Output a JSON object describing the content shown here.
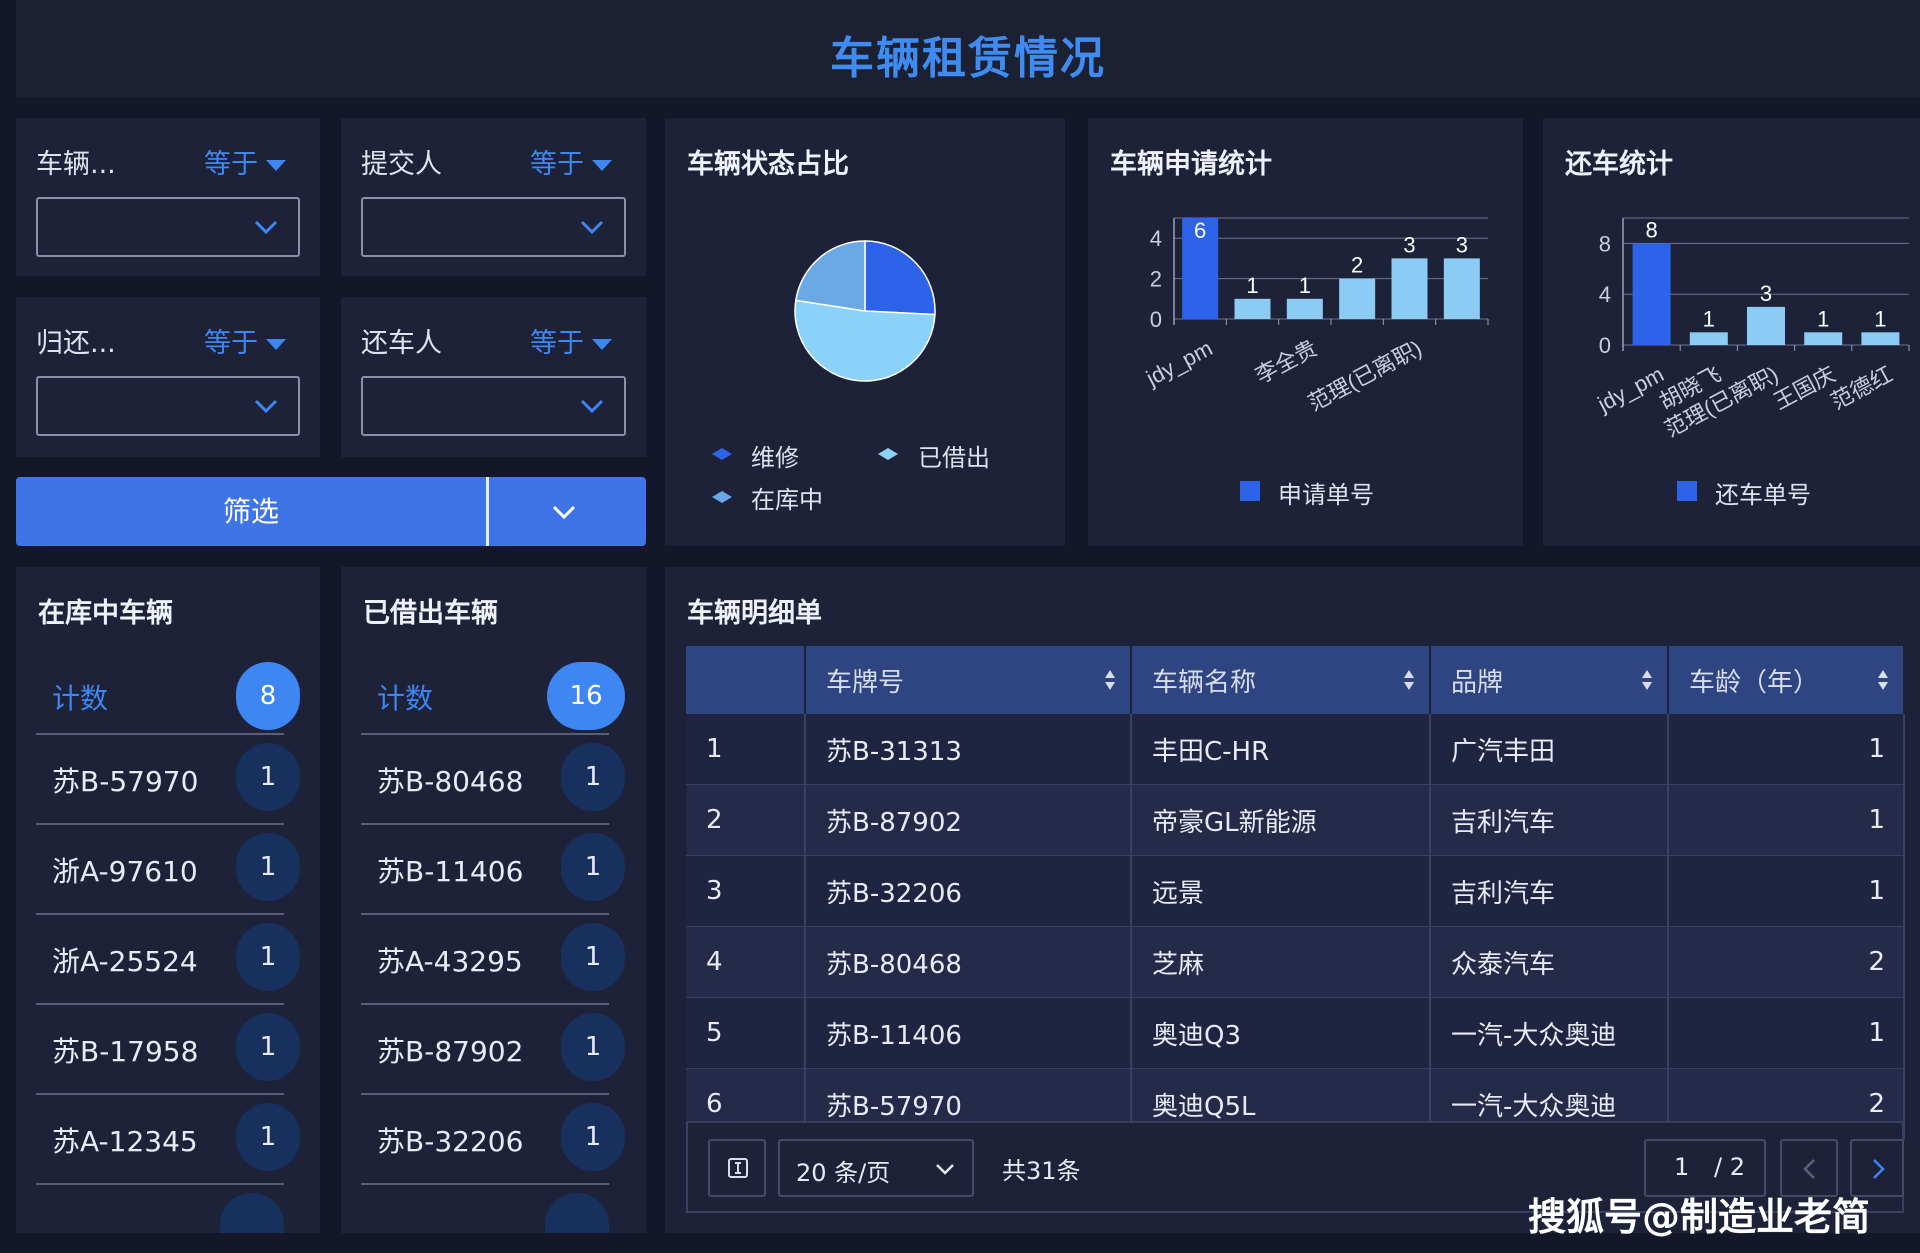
{
  "header": {
    "title": "车辆租赁情况"
  },
  "filters": [
    {
      "label": "车辆...",
      "operator": "等于"
    },
    {
      "label": "提交人",
      "operator": "等于"
    },
    {
      "label": "归还...",
      "operator": "等于"
    },
    {
      "label": "还车人",
      "operator": "等于"
    }
  ],
  "filter_button": {
    "label": "筛选"
  },
  "status_pie": {
    "title": "车辆状态占比",
    "legend": [
      "维修",
      "已借出",
      "在库中"
    ],
    "colors": {
      "维修": "#2d63e8",
      "已借出": "#8ad2f8",
      "在库中": "#6aa8e6"
    }
  },
  "apply_chart_panel": {
    "title": "车辆申请统计",
    "legend": "申请单号"
  },
  "return_chart_panel": {
    "title": "还车统计",
    "legend": "还车单号"
  },
  "chart_data": [
    {
      "type": "pie",
      "title": "车辆状态占比",
      "labels": [
        "维修",
        "已借出",
        "在库中"
      ],
      "values": [
        8,
        16,
        7
      ]
    },
    {
      "type": "bar",
      "title": "车辆申请统计",
      "categories": [
        "jdy_pm",
        "",
        "李全贵",
        "",
        "范理(已离职)",
        ""
      ],
      "series": [
        {
          "name": "申请单号",
          "values": [
            6,
            1,
            1,
            2,
            3,
            3
          ]
        }
      ],
      "yticks": [
        "0",
        "2",
        "4"
      ],
      "ylim": [
        0,
        5
      ]
    },
    {
      "type": "bar",
      "title": "还车统计",
      "categories": [
        "jdy_pm",
        "胡晓飞",
        "范理(已离职)",
        "王国庆",
        "范德红"
      ],
      "series": [
        {
          "name": "还车单号",
          "values": [
            8,
            1,
            3,
            1,
            1
          ]
        }
      ],
      "yticks": [
        "0",
        "4",
        "8"
      ],
      "ylim": [
        0,
        10
      ]
    }
  ],
  "in_stock": {
    "title": "在库中车辆",
    "count_label": "计数",
    "count": "8",
    "items": [
      {
        "plate": "苏B-57970",
        "count": "1"
      },
      {
        "plate": "浙A-97610",
        "count": "1"
      },
      {
        "plate": "浙A-25524",
        "count": "1"
      },
      {
        "plate": "苏B-17958",
        "count": "1"
      },
      {
        "plate": "苏A-12345",
        "count": "1"
      }
    ]
  },
  "lent_out": {
    "title": "已借出车辆",
    "count_label": "计数",
    "count": "16",
    "items": [
      {
        "plate": "苏B-80468",
        "count": "1"
      },
      {
        "plate": "苏B-11406",
        "count": "1"
      },
      {
        "plate": "苏A-43295",
        "count": "1"
      },
      {
        "plate": "苏B-87902",
        "count": "1"
      },
      {
        "plate": "苏B-32206",
        "count": "1"
      }
    ]
  },
  "detail": {
    "title": "车辆明细单",
    "columns": [
      "",
      "车牌号",
      "车辆名称",
      "品牌",
      "车龄（年）"
    ],
    "rows": [
      [
        "1",
        "苏B-31313",
        "丰田C-HR",
        "广汽丰田",
        "1"
      ],
      [
        "2",
        "苏B-87902",
        "帝豪GL新能源",
        "吉利汽车",
        "1"
      ],
      [
        "3",
        "苏B-32206",
        "远景",
        "吉利汽车",
        "1"
      ],
      [
        "4",
        "苏B-80468",
        "芝麻",
        "众泰汽车",
        "2"
      ],
      [
        "5",
        "苏B-11406",
        "奥迪Q3",
        "一汽-大众奥迪",
        "1"
      ],
      [
        "6",
        "苏B-57970",
        "奥迪Q5L",
        "一汽-大众奥迪",
        "2"
      ]
    ],
    "pager": {
      "page_size": "20 条/页",
      "total": "共31条",
      "page": "1",
      "pages": "/ 2"
    }
  },
  "watermark": "搜狐号@制造业老简"
}
